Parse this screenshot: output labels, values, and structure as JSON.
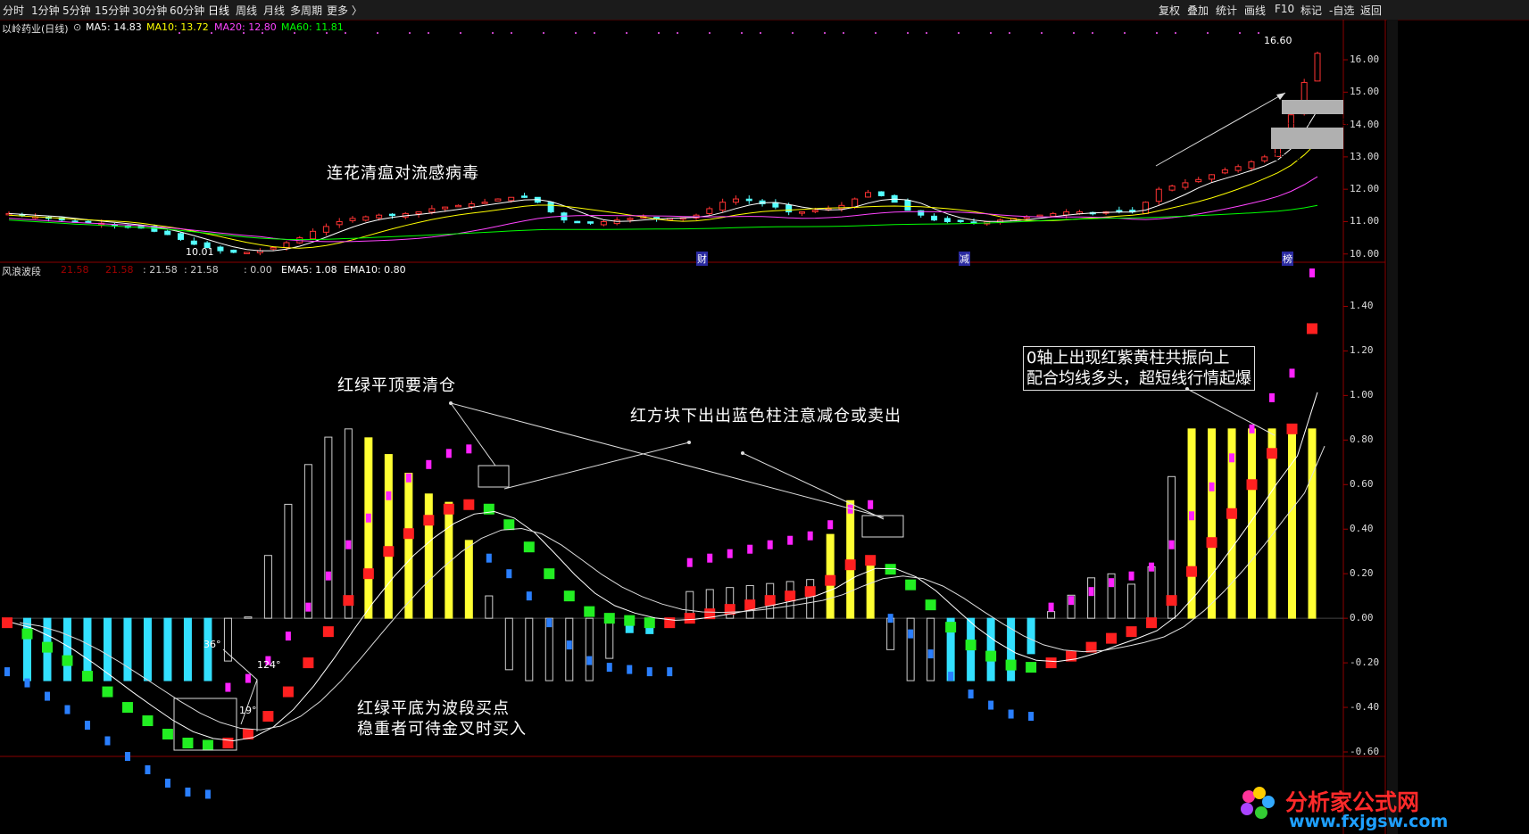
{
  "toolbar": {
    "periods": [
      "分时",
      "1分钟",
      "5分钟",
      "15分钟",
      "30分钟",
      "60分钟",
      "日线",
      "周线",
      "月线",
      "多周期",
      "更多 〉"
    ],
    "active": "日线",
    "right": [
      "复权",
      "叠加",
      "统计",
      "画线",
      "F10",
      "标记",
      "-自选",
      "返回"
    ]
  },
  "price_header": {
    "stock": "以岭药业(日线)",
    "ma5": "MA5: 14.83",
    "ma10": "MA10: 13.72",
    "ma20": "MA20: 12.80",
    "ma60": "MA60: 11.81"
  },
  "indicator_header": {
    "name": "风浪波段",
    "v1": "21.58",
    "v2": "21.58",
    "v3": ": 21.58",
    "v4": ": 21.58",
    "v5": ": 0.00",
    "ema5": "EMA5: 1.08",
    "ema10": "EMA10: 0.80"
  },
  "price_axis": [
    "16.00",
    "15.00",
    "14.00",
    "13.00",
    "12.00",
    "11.00",
    "10.00"
  ],
  "indicator_axis": [
    "1.40",
    "1.20",
    "1.00",
    "0.80",
    "0.60",
    "0.40",
    "0.20",
    "0.00",
    "-0.20",
    "-0.40",
    "-0.60"
  ],
  "price_marks": {
    "high": "16.60",
    "low": "10.01",
    "zone_upper": "14.19 - 14.63",
    "zone_lower": "13.09 - 13.80"
  },
  "event_marks": [
    "财",
    "减",
    "榜"
  ],
  "annotations": {
    "lianhua": "连花清瘟对流感病毒",
    "top_clear": "红绿平顶要清仓",
    "red_block": "红方块下出出蓝色柱注意减仓或卖出",
    "bottom_1": "红绿平底为波段买点",
    "bottom_2": "稳重者可待金叉时买入",
    "resonance_1": "0轴上出现红紫黄柱共振向上",
    "resonance_2": "配合均线多头，超短线行情起爆",
    "angle_36": "36°",
    "angle_124": "124°",
    "angle_19": "19°"
  },
  "watermark": {
    "title": "分析家公式网",
    "url": "www.fxjgsw.com"
  },
  "colors": {
    "ma5": "#ffffff",
    "ma10": "#ffff00",
    "ma20": "#ff44ff",
    "ma60": "#00ff00",
    "up": "#ff3333",
    "down": "#54ffff",
    "wave_up": "#ff2020",
    "wave_down": "#22ee22",
    "bar_magenta": "#ff22ff",
    "bar_yellow": "#ffff33",
    "bar_cyan": "#33e0ff",
    "bar_blue": "#2a7fff",
    "bar_outline": "#d0d0d0"
  },
  "chart_data": {
    "type": "line",
    "price_ylim": [
      9.8,
      16.8
    ],
    "indicator_ylim": [
      -0.62,
      1.55
    ],
    "price_path": [
      11.25,
      11.2,
      11.15,
      11.1,
      11.05,
      11.0,
      10.98,
      10.95,
      10.9,
      10.85,
      10.8,
      10.7,
      10.6,
      10.45,
      10.3,
      10.2,
      10.1,
      10.05,
      10.05,
      10.1,
      10.2,
      10.35,
      10.5,
      10.7,
      10.85,
      11.0,
      11.1,
      11.15,
      11.2,
      11.2,
      11.25,
      11.3,
      11.4,
      11.45,
      11.5,
      11.55,
      11.6,
      11.7,
      11.75,
      11.75,
      11.6,
      11.3,
      11.05,
      10.98,
      10.95,
      11.0,
      11.05,
      11.1,
      11.15,
      11.1,
      11.1,
      11.12,
      11.2,
      11.4,
      11.6,
      11.7,
      11.65,
      11.55,
      11.45,
      11.3,
      11.3,
      11.35,
      11.4,
      11.5,
      11.7,
      11.9,
      11.8,
      11.6,
      11.35,
      11.2,
      11.05,
      11.0,
      11.0,
      10.98,
      11.0,
      11.05,
      11.1,
      11.15,
      11.2,
      11.25,
      11.3,
      11.3,
      11.28,
      11.3,
      11.3,
      11.3,
      11.6,
      12.0,
      12.1,
      12.2,
      12.3,
      12.45,
      12.6,
      12.7,
      12.85,
      13.0,
      13.4,
      14.3,
      15.3,
      16.2
    ],
    "wave_levels": [
      -0.02,
      -0.07,
      -0.13,
      -0.19,
      -0.26,
      -0.33,
      -0.4,
      -0.46,
      -0.52,
      -0.56,
      -0.57,
      -0.56,
      -0.52,
      -0.44,
      -0.33,
      -0.2,
      -0.06,
      0.08,
      0.2,
      0.3,
      0.38,
      0.44,
      0.49,
      0.51,
      0.49,
      0.42,
      0.32,
      0.2,
      0.1,
      0.03,
      0.0,
      -0.01,
      -0.02,
      -0.02,
      0.0,
      0.02,
      0.04,
      0.06,
      0.08,
      0.1,
      0.12,
      0.17,
      0.24,
      0.26,
      0.22,
      0.15,
      0.06,
      -0.04,
      -0.12,
      -0.17,
      -0.21,
      -0.22,
      -0.2,
      -0.17,
      -0.13,
      -0.09,
      -0.06,
      -0.02,
      0.08,
      0.21,
      0.34,
      0.47,
      0.6,
      0.74,
      0.85,
      1.3
    ]
  }
}
